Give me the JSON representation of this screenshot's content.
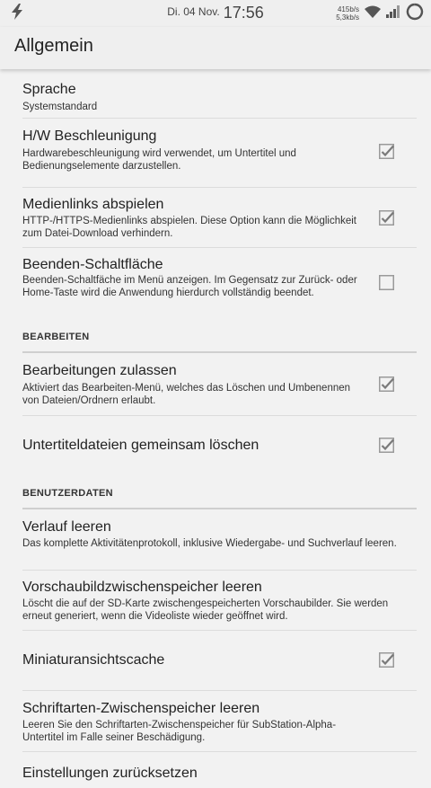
{
  "status_bar": {
    "date": "Di. 04 Nov.",
    "time": "17:56",
    "speed_up": "415b/s",
    "speed_down": "5,3kb/s",
    "icons": [
      "flash-icon",
      "wifi-icon",
      "signal-icon",
      "battery-icon"
    ]
  },
  "header": {
    "title": "Allgemein"
  },
  "prefs": {
    "sprache": {
      "title": "Sprache",
      "summary": "Systemstandard"
    },
    "hw": {
      "title": "H/W Beschleunigung",
      "summary": "Hardwarebeschleunigung wird verwendet, um Untertitel und Bedienungselemente darzustellen.",
      "checked": true
    },
    "medienlinks": {
      "title": "Medienlinks abspielen",
      "summary": "HTTP-/HTTPS-Medienlinks abspielen. Diese Option kann die Möglichkeit zum Datei-Download verhindern.",
      "checked": true
    },
    "beenden": {
      "title": "Beenden-Schaltfläche",
      "summary": "Beenden-Schaltfäche im Menü anzeigen. Im Gegensatz zur Zurück- oder Home-Taste wird die Anwendung hierdurch vollständig beendet.",
      "checked": false
    },
    "bearbeitungen": {
      "title": "Bearbeitungen zulassen",
      "summary": "Aktiviert das Bearbeiten-Menü, welches das Löschen und Umbenennen von Dateien/Ordnern erlaubt.",
      "checked": true
    },
    "untertitel": {
      "title": "Untertiteldateien gemeinsam löschen",
      "checked": true
    },
    "verlauf": {
      "title": "Verlauf leeren",
      "summary": "Das komplette Aktivitätenprotokoll, inklusive Wiedergabe- und Suchverlauf leeren."
    },
    "vorschau": {
      "title": "Vorschaubildzwischenspeicher leeren",
      "summary": "Löscht die auf der SD-Karte zwischengespeicherten Vorschaubilder. Sie werden erneut generiert, wenn die Videoliste wieder geöffnet wird."
    },
    "miniatur": {
      "title": "Miniaturansichtscache",
      "checked": true
    },
    "schriftarten": {
      "title": "Schriftarten-Zwischenspeicher leeren",
      "summary": "Leeren Sie den Schriftarten-Zwischenspeicher für SubStation-Alpha-Untertitel im Falle seiner Beschädigung."
    },
    "reset": {
      "title": "Einstellungen zurücksetzen"
    }
  },
  "categories": {
    "bearbeiten": "BEARBEITEN",
    "benutzerdaten": "BENUTZERDATEN"
  }
}
